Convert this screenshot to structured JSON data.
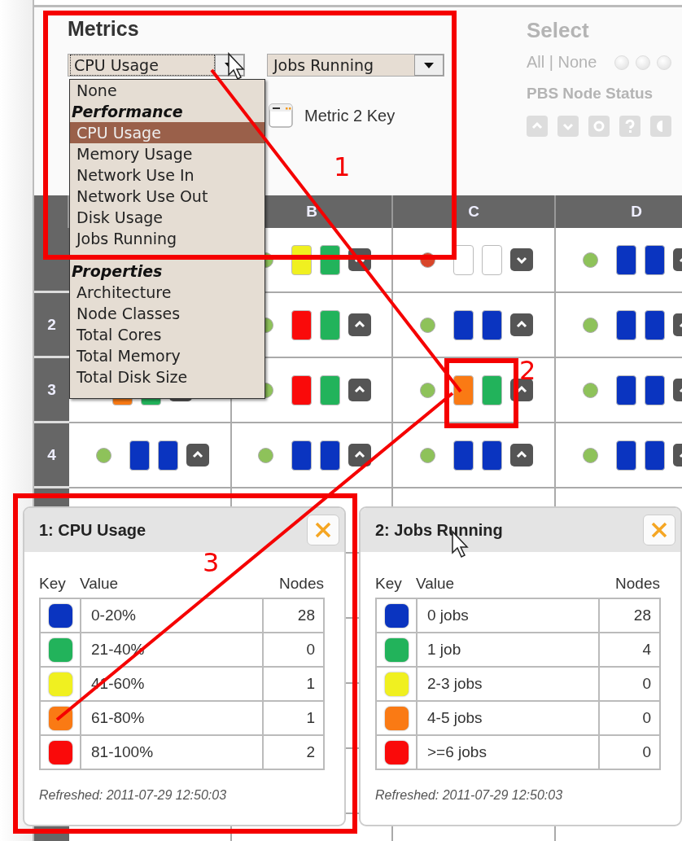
{
  "metrics": {
    "title": "Metrics",
    "select_1": {
      "value": "CPU Usage",
      "focused": true
    },
    "select_2": {
      "value": "Jobs Running",
      "focused": false
    },
    "menu": {
      "items": [
        {
          "kind": "option",
          "label": "None",
          "selected": false
        },
        {
          "kind": "group",
          "label": "Performance"
        },
        {
          "kind": "option",
          "label": "CPU Usage",
          "selected": true
        },
        {
          "kind": "option",
          "label": "Memory Usage",
          "selected": false
        },
        {
          "kind": "option",
          "label": "Network Use In",
          "selected": false
        },
        {
          "kind": "option",
          "label": "Network Use Out",
          "selected": false
        },
        {
          "kind": "option",
          "label": "Disk Usage",
          "selected": false
        },
        {
          "kind": "option",
          "label": "Jobs Running",
          "selected": false
        },
        {
          "kind": "group",
          "label": "Properties"
        },
        {
          "kind": "option",
          "label": "Architecture",
          "selected": false
        },
        {
          "kind": "option",
          "label": "Node Classes",
          "selected": false
        },
        {
          "kind": "option",
          "label": "Total Cores",
          "selected": false
        },
        {
          "kind": "option",
          "label": "Total Memory",
          "selected": false
        },
        {
          "kind": "option",
          "label": "Total Disk Size",
          "selected": false
        }
      ]
    },
    "key_button": {
      "label": "Metric 2 Key"
    }
  },
  "select_panel": {
    "title": "Select",
    "all_none": "All | None",
    "status_label": "PBS Node Status"
  },
  "grid": {
    "columns": [
      "B",
      "C",
      "D"
    ],
    "rows": [
      {
        "cells": [
          null,
          {
            "status": {
              "color": "#8ec25a"
            },
            "tiles": [
              {
                "color": "#f0f020"
              },
              {
                "color": "#22b35b"
              }
            ],
            "expanded": true
          },
          {
            "status": {
              "color": "#d9462a"
            },
            "tiles": [
              {
                "color": "#ffffff"
              },
              {
                "color": "#ffffff"
              }
            ],
            "expanded": false
          },
          {
            "status": {
              "color": "#8ec25a"
            },
            "tiles": [
              {
                "color": "#0a34c0"
              },
              {
                "color": "#0a34c0"
              }
            ],
            "expanded": true
          }
        ]
      },
      {
        "label": "2",
        "cells": [
          null,
          {
            "status": {
              "color": "#8ec25a"
            },
            "tiles": [
              {
                "color": "#fa0a0a"
              },
              {
                "color": "#22b35b"
              }
            ],
            "expanded": true
          },
          {
            "status": {
              "color": "#8ec25a"
            },
            "tiles": [
              {
                "color": "#0a34c0"
              },
              {
                "color": "#0a34c0"
              }
            ],
            "expanded": true
          },
          {
            "status": {
              "color": "#8ec25a"
            },
            "tiles": [
              {
                "color": "#0a34c0"
              },
              {
                "color": "#0a34c0"
              }
            ],
            "expanded": true
          }
        ]
      },
      {
        "label": "3",
        "cells": [
          {
            "tiles": [
              {
                "color": "#fa7a14"
              },
              {
                "color": "#22b35b"
              }
            ]
          },
          {
            "status": {
              "color": "#8ec25a"
            },
            "tiles": [
              {
                "color": "#fa0a0a"
              },
              {
                "color": "#22b35b"
              }
            ],
            "expanded": true
          },
          {
            "status": {
              "color": "#8ec25a"
            },
            "tiles": [
              {
                "color": "#fa7a14"
              },
              {
                "color": "#22b35b"
              }
            ],
            "expanded": true
          },
          {
            "status": {
              "color": "#8ec25a"
            },
            "tiles": [
              {
                "color": "#0a34c0"
              },
              {
                "color": "#0a34c0"
              }
            ],
            "expanded": true
          }
        ]
      },
      {
        "label": "4",
        "cells": [
          {
            "status": {
              "color": "#8ec25a"
            },
            "tiles": [
              {
                "color": "#0a34c0"
              },
              {
                "color": "#0a34c0"
              }
            ],
            "expanded": true
          },
          {
            "status": {
              "color": "#8ec25a"
            },
            "tiles": [
              {
                "color": "#0a34c0"
              },
              {
                "color": "#0a34c0"
              }
            ],
            "expanded": true
          },
          {
            "status": {
              "color": "#8ec25a"
            },
            "tiles": [
              {
                "color": "#0a34c0"
              },
              {
                "color": "#0a34c0"
              }
            ],
            "expanded": true
          },
          {
            "status": {
              "color": "#8ec25a"
            },
            "tiles": [
              {
                "color": "#0a34c0"
              },
              {
                "color": "#0a34c0"
              }
            ],
            "expanded": true
          }
        ]
      }
    ]
  },
  "key_popups": [
    {
      "title": "1: CPU Usage",
      "headers": [
        "Key",
        "Value",
        "Nodes"
      ],
      "rows": [
        {
          "color": "#0a34c0",
          "value": "0-20%",
          "nodes": "28"
        },
        {
          "color": "#22b35b",
          "value": "21-40%",
          "nodes": "0"
        },
        {
          "color": "#f0f020",
          "value": "41-60%",
          "nodes": "1"
        },
        {
          "color": "#fa7a14",
          "value": "61-80%",
          "nodes": "1"
        },
        {
          "color": "#fa0a0a",
          "value": "81-100%",
          "nodes": "2"
        }
      ],
      "refreshed": "Refreshed: 2011-07-29 12:50:03"
    },
    {
      "title": "2: Jobs Running",
      "headers": [
        "Key",
        "Value",
        "Nodes"
      ],
      "rows": [
        {
          "color": "#0a34c0",
          "value": "0 jobs",
          "nodes": "28"
        },
        {
          "color": "#22b35b",
          "value": "1 job",
          "nodes": "4"
        },
        {
          "color": "#f0f020",
          "value": "2-3 jobs",
          "nodes": "0"
        },
        {
          "color": "#fa7a14",
          "value": "4-5 jobs",
          "nodes": "0"
        },
        {
          "color": "#fa0a0a",
          "value": ">=6 jobs",
          "nodes": "0"
        }
      ],
      "refreshed": "Refreshed: 2011-07-29 12:50:03"
    }
  ],
  "annotations": [
    {
      "label": "1"
    },
    {
      "label": "2"
    },
    {
      "label": "3"
    }
  ]
}
